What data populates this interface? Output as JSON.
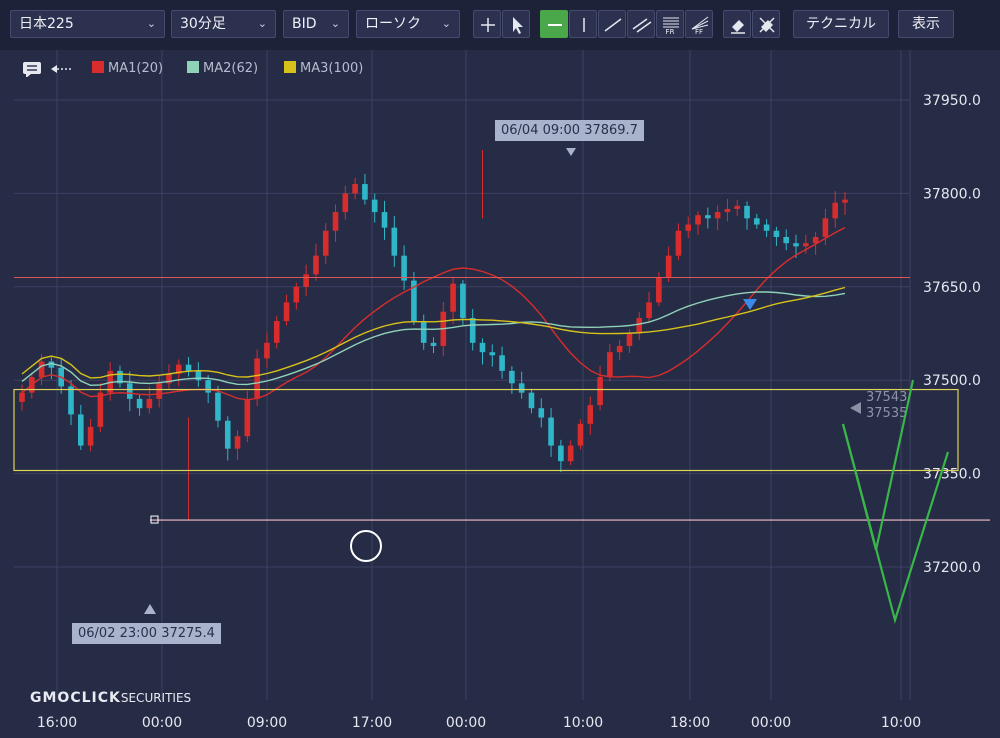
{
  "toolbar": {
    "symbol": "日本225",
    "interval": "30分足",
    "price_type": "BID",
    "chart_type": "ローソク",
    "technical": "テクニカル",
    "display": "表示",
    "tools": [
      {
        "name": "crosshair-tool-button",
        "icon": "crosshair-icon",
        "active": false
      },
      {
        "name": "pointer-tool-button",
        "icon": "cursor-icon",
        "active": false
      },
      {
        "name": "horizontal-line-tool-button",
        "icon": "horizontal-line-icon",
        "active": true
      },
      {
        "name": "vertical-line-tool-button",
        "icon": "vertical-line-icon",
        "active": false
      },
      {
        "name": "trend-line-tool-button",
        "icon": "trend-line-icon",
        "active": false
      },
      {
        "name": "parallel-lines-tool-button",
        "icon": "parallel-lines-icon",
        "active": false
      },
      {
        "name": "fibonacci-retracement-tool-button",
        "icon": "fibonacci-retracement-icon",
        "label": "FR",
        "active": false
      },
      {
        "name": "fibonacci-fan-tool-button",
        "icon": "fibonacci-fan-icon",
        "label": "FF",
        "active": false
      },
      {
        "name": "eraser-tool-button",
        "icon": "eraser-icon",
        "active": false
      },
      {
        "name": "erase-all-tool-button",
        "icon": "erase-all-icon",
        "active": false
      }
    ]
  },
  "legend": {
    "icons": [
      "comment-icon",
      "arrow-left-icon"
    ],
    "items": [
      {
        "label": "MA1(20)",
        "color": "#d92d2d"
      },
      {
        "label": "MA2(62)",
        "color": "#8fd2b8"
      },
      {
        "label": "MA3(100)",
        "color": "#d6c21a"
      }
    ]
  },
  "chart_data": {
    "type": "candlestick",
    "instrument": "日本225",
    "timeframe": "30分足",
    "y_ticks": [
      37950.0,
      37800.0,
      37650.0,
      37500.0,
      37350.0,
      37200.0
    ],
    "y_tick_labels": [
      "37950.0",
      "37800.0",
      "37650.0",
      "37500.0",
      "37350.0",
      "37200.0"
    ],
    "ylim": [
      37164,
      38006
    ],
    "x_tick_labels": [
      "16:00",
      "00:00",
      "09:00",
      "17:00",
      "00:00",
      "10:00",
      "18:00",
      "00:00",
      "10:00"
    ],
    "colors": {
      "up": "#d92d2d",
      "down": "#2fb7c9"
    },
    "candle_count": 85,
    "closes": [
      37480,
      37505,
      37530,
      37520,
      37490,
      37445,
      37395,
      37425,
      37480,
      37515,
      37495,
      37470,
      37455,
      37470,
      37495,
      37510,
      37525,
      37515,
      37500,
      37480,
      37435,
      37390,
      37410,
      37470,
      37535,
      37560,
      37595,
      37625,
      37650,
      37670,
      37700,
      37740,
      37770,
      37800,
      37815,
      37790,
      37770,
      37745,
      37700,
      37660,
      37595,
      37560,
      37555,
      37610,
      37655,
      37600,
      37560,
      37545,
      37540,
      37515,
      37495,
      37480,
      37455,
      37440,
      37395,
      37370,
      37395,
      37430,
      37460,
      37505,
      37545,
      37555,
      37575,
      37600,
      37625,
      37665,
      37700,
      37740,
      37750,
      37765,
      37760,
      37770,
      37775,
      37780,
      37760,
      37750,
      37740,
      37730,
      37720,
      37715,
      37720,
      37730,
      37760,
      37785,
      37790
    ],
    "callouts": [
      {
        "label": "06/04 09:00 37869.7",
        "price": 37869.7
      },
      {
        "label": "06/02 23:00 37275.4",
        "price": 37275.4
      }
    ],
    "ma": [
      {
        "name": "MA1(20)",
        "color": "#d92d2d"
      },
      {
        "name": "MA2(62)",
        "color": "#8fd2b8"
      },
      {
        "name": "MA3(100)",
        "color": "#d6c21a"
      }
    ],
    "horizontal_line": {
      "price": 37665,
      "color": "#e05555"
    },
    "support_zone": {
      "from": 37355,
      "to": 37485,
      "color": "#ddd35a"
    },
    "low_line": {
      "price": 37275.4,
      "color": "#f2c0c8"
    },
    "current_price_labels": [
      "37543",
      "37535"
    ],
    "scenario_arrows_color": "#39b54a",
    "xlabel": "",
    "ylabel": ""
  },
  "brand": {
    "main": "GMOCLICK",
    "sub": "SECURITIES"
  }
}
